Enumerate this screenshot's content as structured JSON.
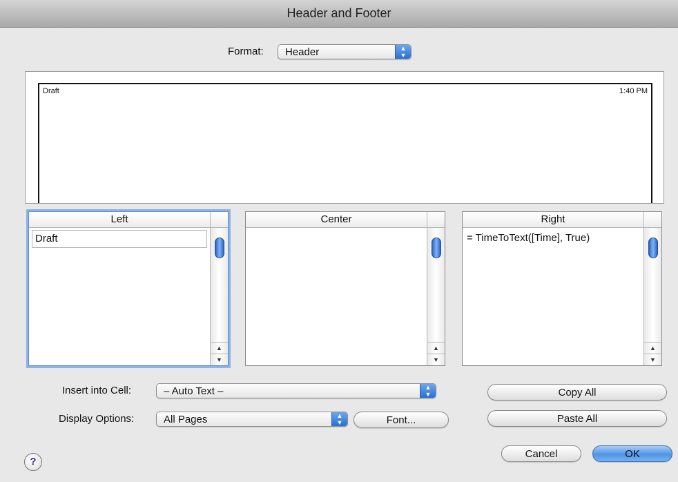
{
  "window": {
    "title": "Header and Footer"
  },
  "format": {
    "label": "Format:",
    "value": "Header"
  },
  "preview": {
    "left_text": "Draft",
    "right_text": "1:40 PM"
  },
  "cells": [
    {
      "header": "Left",
      "value": "Draft"
    },
    {
      "header": "Center",
      "value": ""
    },
    {
      "header": "Right",
      "value": "= TimeToText([Time], True)"
    }
  ],
  "insert": {
    "label": "Insert into Cell:",
    "value": "– Auto Text –"
  },
  "display": {
    "label": "Display Options:",
    "value": "All Pages"
  },
  "buttons": {
    "font": "Font...",
    "copy_all": "Copy All",
    "paste_all": "Paste All",
    "cancel": "Cancel",
    "ok": "OK"
  },
  "help": {
    "symbol": "?"
  },
  "icons": {
    "popup_arrows": "updown-arrows-icon",
    "scroll_up": "scroll-up-arrow-icon",
    "scroll_down": "scroll-down-arrow-icon",
    "help": "help-icon"
  },
  "colors": {
    "accent": "#4f95e6",
    "focus_ring": "#8cb3e6"
  }
}
